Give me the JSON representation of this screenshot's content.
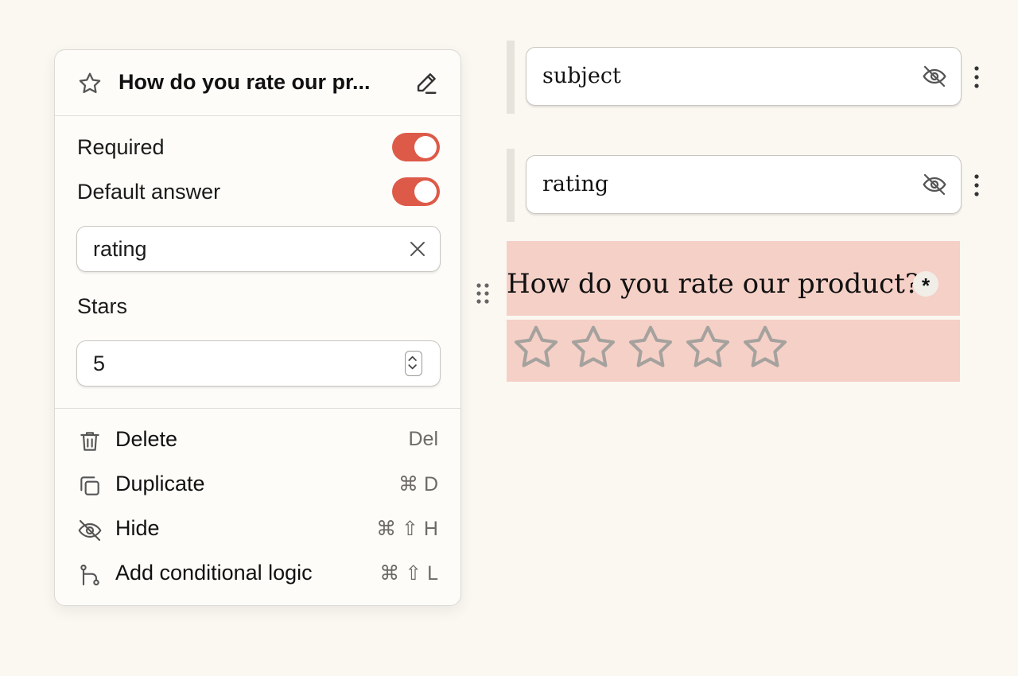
{
  "panel": {
    "title": "How do you rate our pr...",
    "required_label": "Required",
    "required_on": true,
    "default_answer_label": "Default answer",
    "default_answer_on": true,
    "default_value": "rating",
    "stars_label": "Stars",
    "stars_value": "5",
    "menu": [
      {
        "label": "Delete",
        "shortcut": "Del",
        "icon": "trash-icon"
      },
      {
        "label": "Duplicate",
        "shortcut": "⌘ D",
        "icon": "duplicate-icon"
      },
      {
        "label": "Hide",
        "shortcut": "⌘ ⇧ H",
        "icon": "eye-off-icon"
      },
      {
        "label": "Add conditional logic",
        "shortcut": "⌘ ⇧ L",
        "icon": "branch-icon"
      }
    ]
  },
  "form": {
    "fields": [
      {
        "label": "subject",
        "hidden": true
      },
      {
        "label": "rating",
        "hidden": true
      }
    ],
    "question": "How do you rate our product?",
    "required_mark": "*",
    "star_count": 5,
    "rating_value": 0
  },
  "colors": {
    "accent": "#de5a48",
    "highlight": "#f5d0c7",
    "star": "#a5a29e",
    "background": "#fbf8f2"
  }
}
